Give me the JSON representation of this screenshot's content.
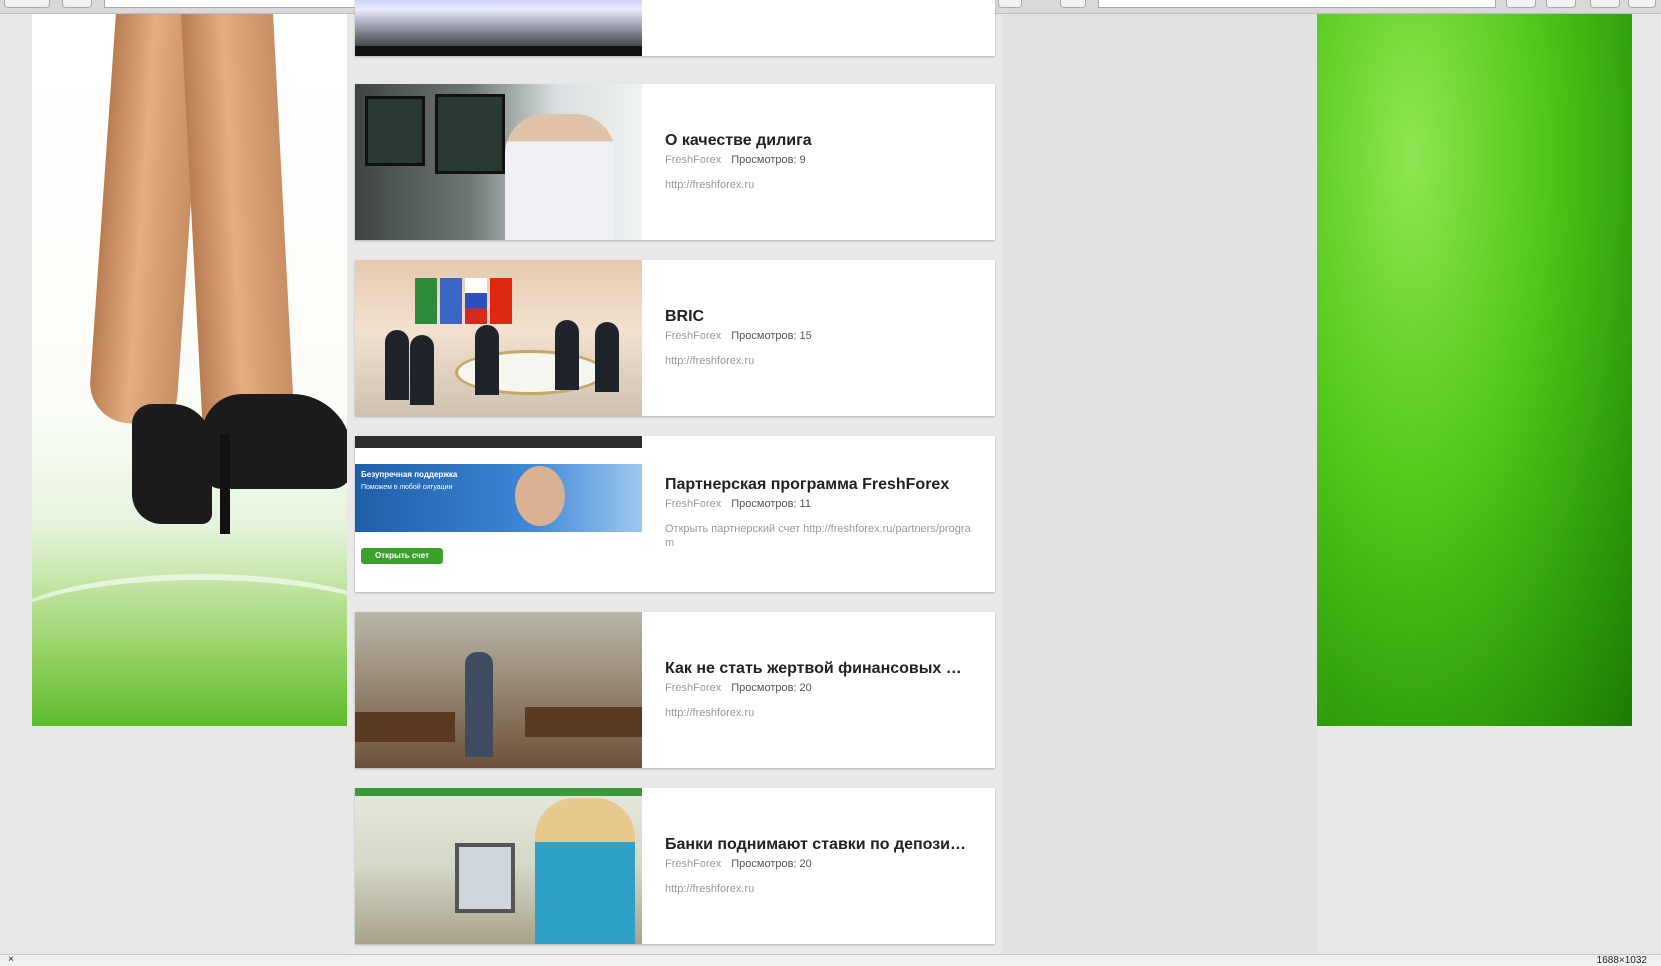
{
  "statusbar": {
    "close_glyph": "×",
    "resolution": "1688×1032"
  },
  "thumbnails": {
    "partner_hero_title": "Безупречная поддержка",
    "partner_hero_sub": "Поможем в любой ситуации",
    "partner_button": "Открыть счет"
  },
  "videos": [
    {
      "title": "",
      "channel": "",
      "views": "",
      "description": ""
    },
    {
      "title": "О качестве дилига",
      "channel": "FreshForex",
      "views": "Просмотров: 9",
      "description": "http://freshforex.ru"
    },
    {
      "title": "BRIC",
      "channel": "FreshForex",
      "views": "Просмотров: 15",
      "description": "http://freshforex.ru"
    },
    {
      "title": "Партнерская программа FreshForex",
      "channel": "FreshForex",
      "views": "Просмотров: 11",
      "description": "Открыть партнерский счет http://freshforex.ru/partners/program"
    },
    {
      "title": "Как не стать жертвой финансовых …",
      "channel": "FreshForex",
      "views": "Просмотров: 20",
      "description": "http://freshforex.ru"
    },
    {
      "title": "Банки поднимают ставки по депози…",
      "channel": "FreshForex",
      "views": "Просмотров: 20",
      "description": "http://freshforex.ru"
    }
  ]
}
